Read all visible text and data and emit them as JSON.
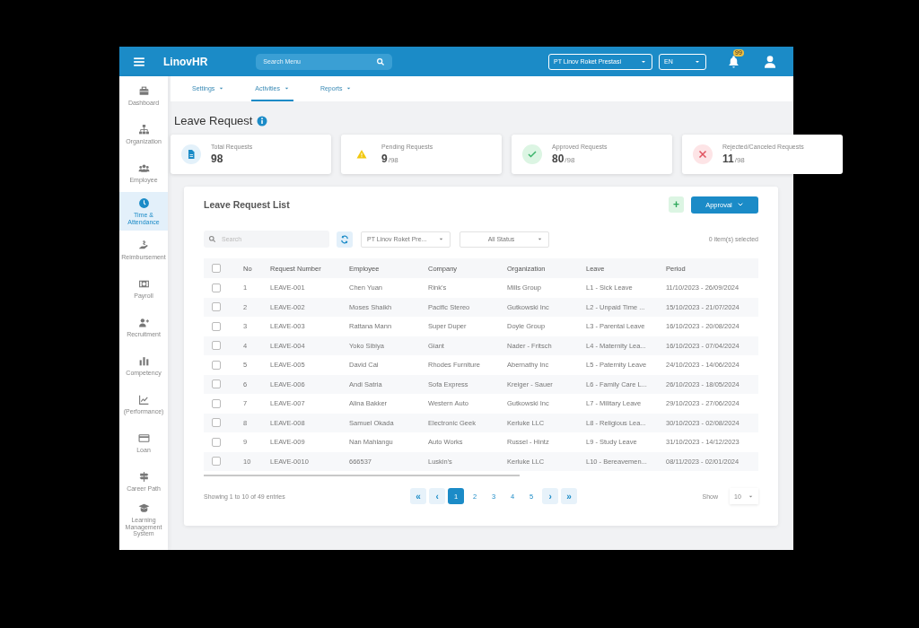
{
  "topbar": {
    "brand": "LinovHR",
    "search": {
      "placeholder": "Search Menu"
    },
    "company": "PT Linov Roket Prestasi",
    "language": "EN",
    "notifications": "99"
  },
  "sidebar": {
    "items": [
      {
        "label": "Dashboard",
        "kind": "briefcase",
        "selected": false
      },
      {
        "label": "Organization",
        "kind": "org",
        "selected": false
      },
      {
        "label": "Employee",
        "kind": "people",
        "selected": false
      },
      {
        "label": "Time & Attendance",
        "kind": "clock",
        "selected": true
      },
      {
        "label": "Reimbursement",
        "kind": "hand",
        "selected": false
      },
      {
        "label": "Payroll",
        "kind": "money",
        "selected": false
      },
      {
        "label": "Recruitment",
        "kind": "person-plus",
        "selected": false
      },
      {
        "label": "Competency",
        "kind": "bars",
        "selected": false
      },
      {
        "label": "(Performance)",
        "kind": "line",
        "selected": false
      },
      {
        "label": "Loan",
        "kind": "card",
        "selected": false
      },
      {
        "label": "Career Path",
        "kind": "sign",
        "selected": false
      },
      {
        "label": "Learning Management System",
        "kind": "cap",
        "selected": false
      }
    ]
  },
  "subnav": {
    "tabs": [
      {
        "label": "Settings",
        "selected": false
      },
      {
        "label": "Activities",
        "selected": true
      },
      {
        "label": "Reports",
        "selected": false
      }
    ]
  },
  "page": {
    "title": "Leave Request"
  },
  "stats": [
    {
      "kind": "total",
      "label": "Total Requests",
      "value": "98"
    },
    {
      "kind": "pending",
      "label": "Pending Requests",
      "value": "9",
      "of_total": "/98"
    },
    {
      "kind": "approved",
      "label": "Approved Requests",
      "value": "80",
      "of_total": "/98"
    },
    {
      "kind": "rejected",
      "label": "Rejected/Canceled Requests",
      "value": "11",
      "of_total": "/98"
    }
  ],
  "list": {
    "title": "Leave Request List",
    "add_button": "+",
    "approval_button": "Approval",
    "search": {
      "placeholder": "Search"
    },
    "company_filter": "PT Linov Roket Pre...",
    "status_filter": "All Status",
    "selected_count": "0 item(s) selected",
    "all_checked": false,
    "columns": [
      "No",
      "Request Number",
      "Employee",
      "Company",
      "Organization",
      "Leave",
      "Period"
    ],
    "rows": [
      {
        "checked": false,
        "cells": [
          "1",
          "LEAVE-001",
          "Chen Yuan",
          "Rink's",
          "Mills Group",
          "L1 - Sick Leave",
          "11/10/2023 - 26/09/2024"
        ]
      },
      {
        "checked": false,
        "cells": [
          "2",
          "LEAVE-002",
          "Moses Shaikh",
          "Pacific Stereo",
          "Gutkowski Inc",
          "L2 - Unpaid Time ...",
          "15/10/2023 - 21/07/2024"
        ]
      },
      {
        "checked": false,
        "cells": [
          "3",
          "LEAVE-003",
          "Rattana Mann",
          "Super Duper",
          "Doyle Group",
          "L3 - Parental Leave",
          "16/10/2023 - 20/08/2024"
        ]
      },
      {
        "checked": false,
        "cells": [
          "4",
          "LEAVE-004",
          "Yoko Sibiya",
          "Giant",
          "Nader - Fritsch",
          "L4 - Maternity Lea...",
          "16/10/2023 - 07/04/2024"
        ]
      },
      {
        "checked": false,
        "cells": [
          "5",
          "LEAVE-005",
          "David Cai",
          "Rhodes Furniture",
          "Abernathy Inc",
          "L5 - Paternity Leave",
          "24/10/2023 - 14/06/2024"
        ]
      },
      {
        "checked": false,
        "cells": [
          "6",
          "LEAVE-006",
          "Andi Satria",
          "Sofa Express",
          "Kreiger - Sauer",
          "L6 - Family Care L...",
          "26/10/2023 - 18/05/2024"
        ]
      },
      {
        "checked": false,
        "cells": [
          "7",
          "LEAVE-007",
          "Alina Bakker",
          "Western Auto",
          "Gutkowski Inc",
          "L7 - Military Leave",
          "29/10/2023 - 27/06/2024"
        ]
      },
      {
        "checked": false,
        "cells": [
          "8",
          "LEAVE-008",
          "Samuel Okada",
          "Electronic Geek",
          "Kerluke LLC",
          "L8 - Religious Lea...",
          "30/10/2023 - 02/08/2024"
        ]
      },
      {
        "checked": false,
        "cells": [
          "9",
          "LEAVE-009",
          "Nan Mahlangu",
          "Auto Works",
          "Russel - Hintz",
          "L9 - Study Leave",
          "31/10/2023 - 14/12/2023"
        ]
      },
      {
        "checked": false,
        "cells": [
          "10",
          "LEAVE-0010",
          "666537",
          "Luskin's",
          "Kerluke LLC",
          "L10 - Bereavemen...",
          "08/11/2023 - 02/01/2024"
        ]
      }
    ]
  },
  "footer": {
    "showing": "Showing 1 to 10 of 49 entries",
    "pages": [
      {
        "label": "«",
        "kind": "nav",
        "selected": false
      },
      {
        "label": "‹",
        "kind": "nav",
        "selected": false
      },
      {
        "label": "1",
        "kind": "page",
        "selected": true
      },
      {
        "label": "2",
        "kind": "page",
        "selected": false
      },
      {
        "label": "3",
        "kind": "page",
        "selected": false
      },
      {
        "label": "4",
        "kind": "page",
        "selected": false
      },
      {
        "label": "5",
        "kind": "page",
        "selected": false
      },
      {
        "label": "›",
        "kind": "nav",
        "selected": false
      },
      {
        "label": "»",
        "kind": "nav",
        "selected": false
      }
    ],
    "show_label": "Show",
    "page_size": "10"
  }
}
